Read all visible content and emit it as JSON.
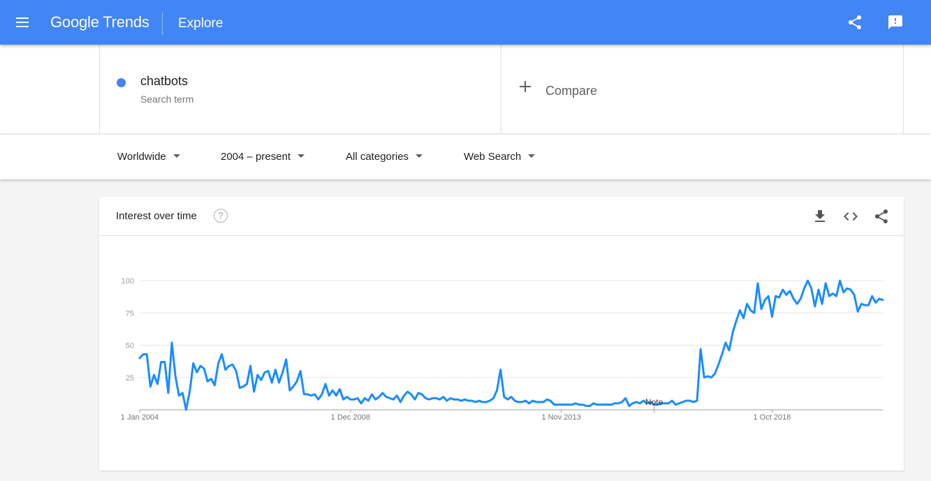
{
  "header": {
    "brand": "Google Trends",
    "page": "Explore",
    "menu_icon": "hamburger-menu-icon",
    "share_icon": "share-icon",
    "feedback_icon": "feedback-icon"
  },
  "search": {
    "term": "chatbots",
    "term_type": "Search term",
    "term_color": "#4285f4",
    "compare_label": "Compare"
  },
  "filters": {
    "region": "Worldwide",
    "time_range": "2004 – present",
    "category": "All categories",
    "property": "Web Search"
  },
  "card": {
    "title": "Interest over time",
    "help_symbol": "?",
    "icons": [
      "download-icon",
      "embed-code-icon",
      "share-icon"
    ]
  },
  "colors": {
    "accent": "#4285f4",
    "series": "#1a8cff"
  },
  "chart_data": {
    "type": "line",
    "x_labels": [
      "1 Jan 2004",
      "1 Dec 2008",
      "1 Nov 2013",
      "1 Oct 2018"
    ],
    "x_label_indices": [
      0,
      59,
      118,
      177
    ],
    "y_ticks": [
      25,
      50,
      75,
      100
    ],
    "ylim": [
      0,
      100
    ],
    "grid": true,
    "note": {
      "label": "Note",
      "index": 144
    },
    "series": [
      {
        "name": "chatbots",
        "values": [
          40,
          43,
          43,
          18,
          27,
          20,
          37,
          37,
          13,
          52,
          26,
          11,
          13,
          0,
          14,
          36,
          29,
          34,
          32,
          22,
          24,
          19,
          36,
          43,
          31,
          34,
          35,
          30,
          17,
          18,
          20,
          34,
          14,
          27,
          23,
          29,
          30,
          21,
          31,
          21,
          29,
          39,
          15,
          18,
          22,
          30,
          12,
          12,
          11,
          12,
          8,
          12,
          20,
          11,
          15,
          11,
          16,
          8,
          10,
          8,
          8,
          9,
          5,
          9,
          7,
          12,
          8,
          10,
          13,
          10,
          9,
          8,
          11,
          6,
          11,
          14,
          12,
          8,
          13,
          12,
          9,
          8,
          9,
          9,
          8,
          10,
          7,
          9,
          8,
          8,
          7,
          8,
          7,
          7,
          6,
          7,
          6,
          6,
          7,
          9,
          15,
          31,
          10,
          8,
          10,
          7,
          6,
          6,
          7,
          5,
          7,
          6,
          6,
          6,
          8,
          7,
          4,
          4,
          4,
          4,
          4,
          4,
          5,
          4,
          4,
          3,
          3,
          5,
          4,
          4,
          4,
          4,
          4,
          5,
          5,
          6,
          9,
          3,
          5,
          6,
          5,
          7,
          5,
          6,
          4,
          4,
          5,
          5,
          5,
          7,
          4,
          5,
          6,
          7,
          7,
          6,
          7,
          47,
          25,
          26,
          25,
          28,
          35,
          43,
          52,
          46,
          60,
          69,
          77,
          71,
          82,
          77,
          75,
          98,
          78,
          85,
          88,
          72,
          88,
          87,
          93,
          89,
          92,
          86,
          82,
          86,
          94,
          100,
          94,
          80,
          93,
          82,
          98,
          88,
          90,
          88,
          100,
          91,
          94,
          93,
          89,
          76,
          82,
          81,
          81,
          88,
          83,
          86,
          85
        ]
      }
    ]
  }
}
